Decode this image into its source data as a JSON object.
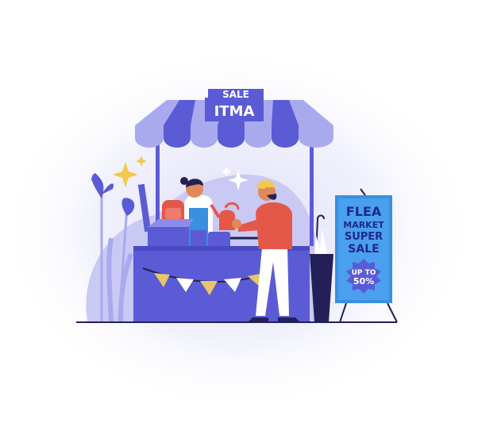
{
  "stall_sign": {
    "title": "ITMA",
    "behind_text": "SALE"
  },
  "poster": {
    "line1": "FLEA",
    "line2": "MARKET",
    "line3": "SUPER",
    "line4": "SALE",
    "badge_line1": "UP TO",
    "badge_line2": "50%"
  },
  "colors": {
    "primary": "#5b5bd6",
    "light_purple": "#a9a9ee",
    "dark_navy": "#232057",
    "poster_blue": "#3a8fe0",
    "poster_text": "#1f2a8a",
    "jacket_red": "#e4584a",
    "cap_yellow": "#f2c94c",
    "flag_yellow": "#e9c46a",
    "sparkle": "#f2c94c"
  }
}
